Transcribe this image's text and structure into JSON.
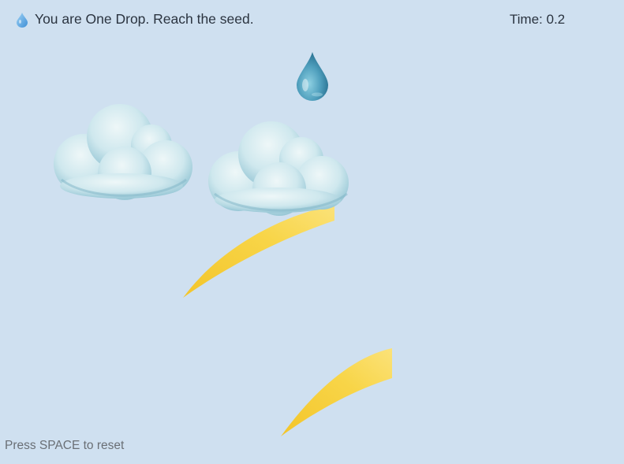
{
  "hud": {
    "icon": "water-drop-icon",
    "title": "You are One Drop. Reach the seed.",
    "time_label": "Time:",
    "time_value": "0.2"
  },
  "hint": "Press SPACE to reset",
  "colors": {
    "sky": "#cfe0f0",
    "drop": "#3f8fb3",
    "cloud": "#d4eaf0",
    "cloud_shade": "#7fb8c8",
    "ray": "#f6cf36"
  },
  "scene": {
    "player": "water-drop",
    "clouds": 2,
    "sun_rays": 2
  }
}
